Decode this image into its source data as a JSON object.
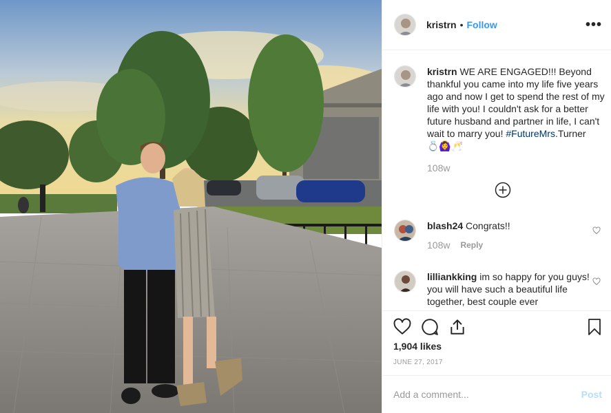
{
  "post": {
    "username": "kristrn",
    "follow_label": "Follow",
    "separator": "•",
    "more_label": "•••",
    "photo_alt": "Couple posing on a plaza at sunset"
  },
  "caption": {
    "username": "kristrn",
    "text": "WE ARE ENGAGED!!! Beyond thankful you came into my life five years ago and now I get to spend the rest of my life with you! I couldn't ask for a better future husband and partner in life, I can't wait to marry you!",
    "hashtag": "#FutureMrs",
    "hashtag_suffix": ".Turner",
    "emojis": "💍🙆‍♀️🥂",
    "age": "108w"
  },
  "comments": [
    {
      "username": "blash24",
      "text": "Congrats!!",
      "age": "108w",
      "reply_label": "Reply"
    },
    {
      "username": "lilliankking",
      "text": "im so happy for you guys! you will have such a beautiful life together, best couple ever"
    }
  ],
  "actions": {
    "likes": "1,904 likes",
    "date": "JUNE 27, 2017"
  },
  "composer": {
    "placeholder": "Add a comment...",
    "post_label": "Post"
  },
  "icons": {
    "load_more": "plus-circle-icon",
    "like": "heart-icon",
    "comment": "comment-bubble-icon",
    "share": "share-icon",
    "save": "bookmark-icon"
  },
  "colors": {
    "link": "#3897f0",
    "hashtag": "#003569",
    "muted": "#999999",
    "post_disabled": "#b2dffc"
  }
}
